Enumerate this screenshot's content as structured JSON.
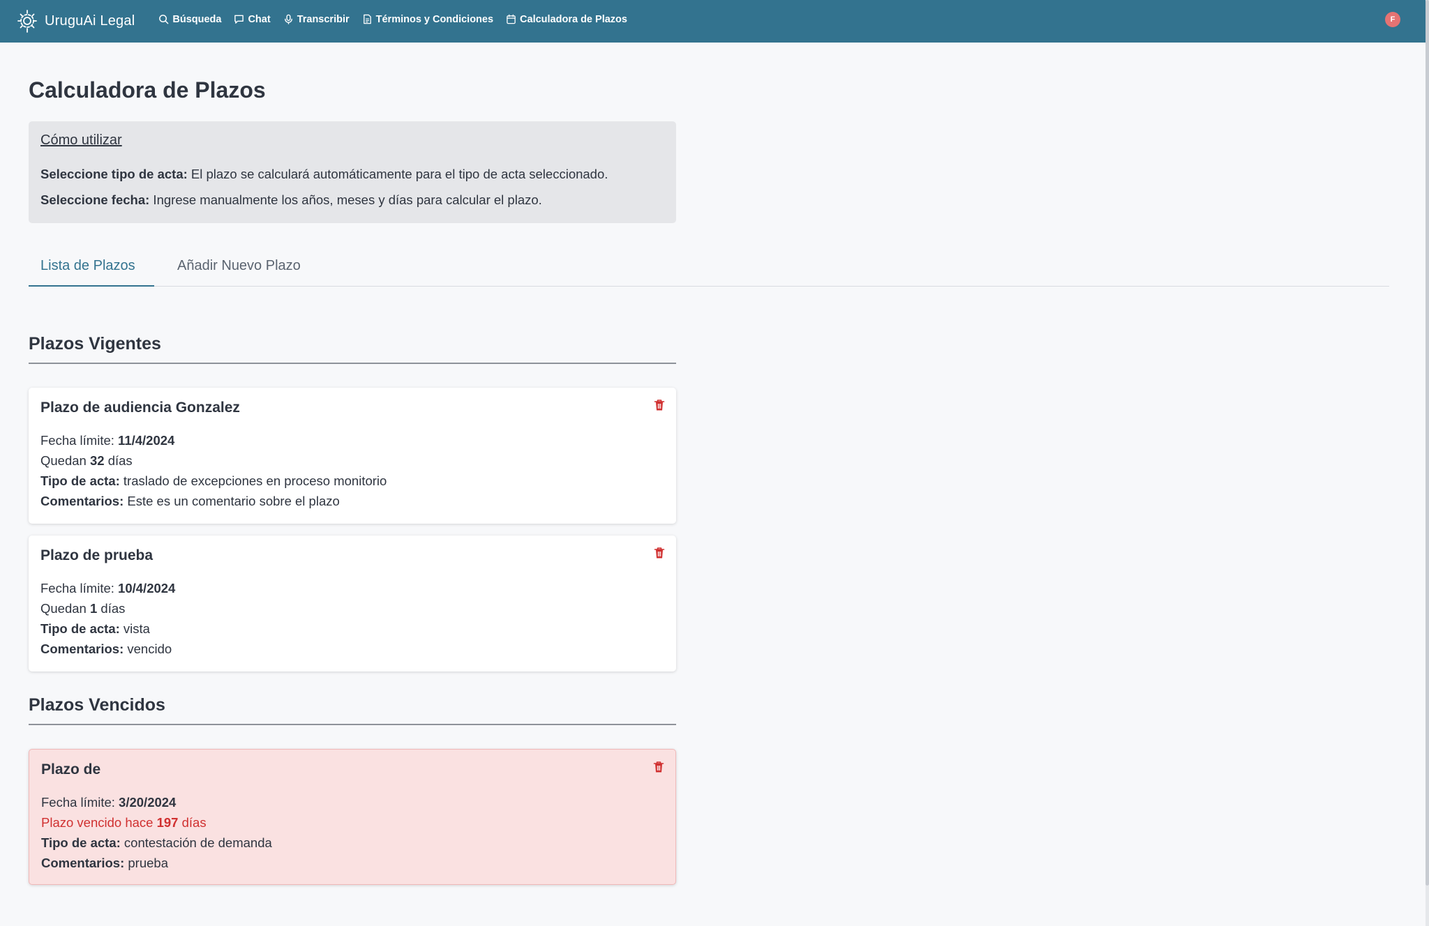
{
  "nav": {
    "brand": "UruguAi Legal",
    "items": [
      {
        "label": "Búsqueda",
        "icon": "search-icon"
      },
      {
        "label": "Chat",
        "icon": "chat-icon"
      },
      {
        "label": "Transcribir",
        "icon": "microphone-icon"
      },
      {
        "label": "Términos y Condiciones",
        "icon": "document-icon"
      },
      {
        "label": "Calculadora de Plazos",
        "icon": "calendar-icon"
      }
    ],
    "avatar": "F"
  },
  "page": {
    "title": "Calculadora de Plazos"
  },
  "info": {
    "title": "Cómo utilizar",
    "line1_label": "Seleccione tipo de acta:",
    "line1_text": " El plazo se calculará automáticamente para el tipo de acta seleccionado.",
    "line2_label": "Seleccione fecha:",
    "line2_text": " Ingrese manualmente los años, meses y días para calcular el plazo."
  },
  "tabs": {
    "active": "Lista de Plazos",
    "inactive": "Añadir Nuevo Plazo"
  },
  "vigentes": {
    "title": "Plazos Vigentes",
    "items": [
      {
        "title": "Plazo de audiencia Gonzalez",
        "fecha_label": "Fecha límite: ",
        "fecha": "11/4/2024",
        "quedan_pre": "Quedan ",
        "dias": "32",
        "quedan_post": " días",
        "tipo_label": "Tipo de acta:",
        "tipo": " traslado de excepciones en proceso monitorio",
        "com_label": "Comentarios:",
        "comentario": " Este es un comentario sobre el plazo"
      },
      {
        "title": "Plazo de prueba",
        "fecha_label": "Fecha límite: ",
        "fecha": "10/4/2024",
        "quedan_pre": "Quedan ",
        "dias": "1",
        "quedan_post": " días",
        "tipo_label": "Tipo de acta:",
        "tipo": " vista",
        "com_label": "Comentarios:",
        "comentario": " vencido"
      }
    ]
  },
  "vencidos": {
    "title": "Plazos Vencidos",
    "items": [
      {
        "title": "Plazo de",
        "fecha_label": "Fecha límite: ",
        "fecha": "3/20/2024",
        "vencido_pre": "Plazo vencido hace ",
        "dias": "197",
        "vencido_post": " días",
        "tipo_label": "Tipo de acta:",
        "tipo": " contestación de demanda",
        "com_label": "Comentarios:",
        "comentario": " prueba"
      }
    ]
  },
  "colors": {
    "navbar": "#33738f",
    "accent": "#33738f",
    "danger": "#d03030",
    "expired_bg": "#fae1e1"
  }
}
